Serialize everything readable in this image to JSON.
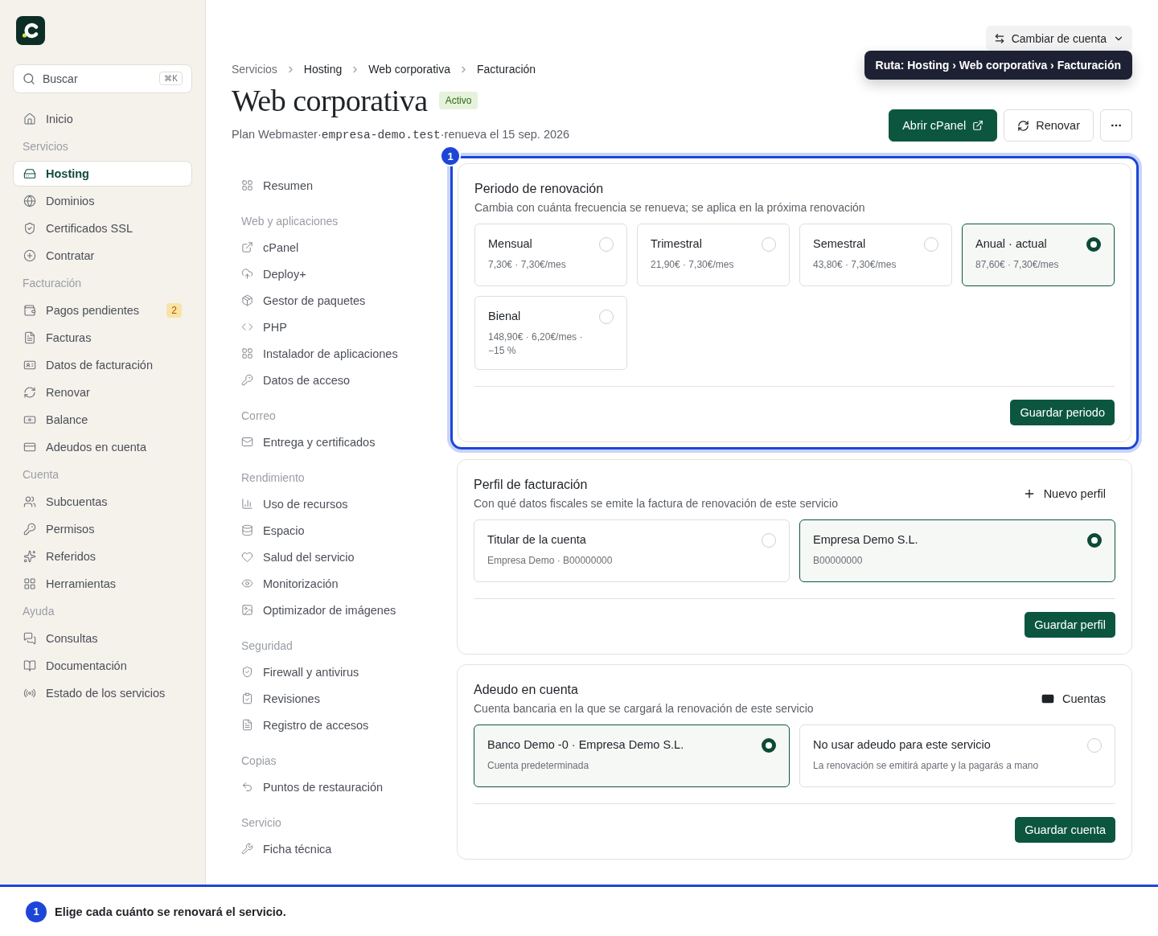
{
  "sidebar": {
    "search": {
      "placeholder": "Buscar",
      "shortcut": "⌘K"
    },
    "items": [
      {
        "kind": "item",
        "label": "Inicio",
        "selected": false
      },
      {
        "kind": "section",
        "label": "Servicios"
      },
      {
        "kind": "item",
        "label": "Hosting",
        "selected": true
      },
      {
        "kind": "item",
        "label": "Dominios",
        "selected": false
      },
      {
        "kind": "item",
        "label": "Certificados SSL",
        "selected": false
      },
      {
        "kind": "item",
        "label": "Contratar",
        "selected": false
      },
      {
        "kind": "section",
        "label": "Facturación"
      },
      {
        "kind": "item",
        "label": "Pagos pendientes",
        "selected": false,
        "badge": "2"
      },
      {
        "kind": "item",
        "label": "Facturas",
        "selected": false
      },
      {
        "kind": "item",
        "label": "Datos de facturación",
        "selected": false
      },
      {
        "kind": "item",
        "label": "Renovar",
        "selected": false
      },
      {
        "kind": "item",
        "label": "Balance",
        "selected": false
      },
      {
        "kind": "item",
        "label": "Adeudos en cuenta",
        "selected": false
      },
      {
        "kind": "section",
        "label": "Cuenta"
      },
      {
        "kind": "item",
        "label": "Subcuentas",
        "selected": false
      },
      {
        "kind": "item",
        "label": "Permisos",
        "selected": false
      },
      {
        "kind": "item",
        "label": "Referidos",
        "selected": false
      },
      {
        "kind": "item",
        "label": "Herramientas",
        "selected": false
      },
      {
        "kind": "section",
        "label": "Ayuda"
      },
      {
        "kind": "item",
        "label": "Consultas",
        "selected": false
      },
      {
        "kind": "item",
        "label": "Documentación",
        "selected": false
      },
      {
        "kind": "item",
        "label": "Estado de los servicios",
        "selected": false
      }
    ]
  },
  "account_switch": {
    "label": "Cambiar de cuenta"
  },
  "breadcrumb": [
    "Servicios",
    "Hosting",
    "Web corporativa",
    "Facturación"
  ],
  "tooltip": "Ruta: Hosting › Web corporativa › Facturación",
  "header": {
    "title": "Web corporativa",
    "status": "Activo",
    "separator": "·",
    "subtitle": [
      {
        "kind": "plain",
        "text": "Plan Webmaster"
      },
      {
        "kind": "code",
        "text": "empresa-demo.test"
      },
      {
        "kind": "plain",
        "text": "renueva el 15 sep. 2026"
      }
    ],
    "actions": [
      {
        "kind": "primary",
        "label": "Abrir cPanel"
      },
      {
        "kind": "secondary",
        "label": "Renovar"
      },
      {
        "kind": "more"
      }
    ]
  },
  "subnav": [
    {
      "items": [
        "Resumen"
      ]
    },
    {
      "title": "Web y aplicaciones",
      "items": [
        "cPanel",
        "Deploy+",
        "Gestor de paquetes",
        "PHP",
        "Instalador de aplicaciones",
        "Datos de acceso"
      ]
    },
    {
      "title": "Correo",
      "items": [
        "Entrega y certificados"
      ]
    },
    {
      "title": "Rendimiento",
      "items": [
        "Uso de recursos",
        "Espacio",
        "Salud del servicio",
        "Monitorización",
        "Optimizador de imágenes"
      ]
    },
    {
      "title": "Seguridad",
      "items": [
        "Firewall y antivirus",
        "Revisiones",
        "Registro de accesos"
      ]
    },
    {
      "title": "Copias",
      "items": [
        "Puntos de restauración"
      ]
    },
    {
      "title": "Servicio",
      "items": [
        "Ficha técnica"
      ]
    }
  ],
  "cards": [
    {
      "kind": "period",
      "highlighted": true,
      "step": "1",
      "title": "Periodo de renovación",
      "description": "Cambia con cuánta frecuencia se renueva; se aplica en la próxima renovación",
      "save": "Guardar periodo",
      "options": [
        {
          "title": "Mensual",
          "detail": "7,30€ · 7,30€/mes",
          "selected": false
        },
        {
          "title": "Trimestral",
          "detail": "21,90€ · 7,30€/mes",
          "selected": false
        },
        {
          "title": "Semestral",
          "detail": "43,80€ · 7,30€/mes",
          "selected": false
        },
        {
          "title": "Anual · actual",
          "detail": "87,60€ · 7,30€/mes",
          "selected": true
        },
        {
          "title": "Bienal",
          "detail": "148,90€ · 6,20€/mes · −15 %",
          "selected": false
        }
      ]
    },
    {
      "kind": "choice",
      "highlighted": false,
      "title": "Perfil de facturación",
      "description": "Con qué datos fiscales se emite la factura de renovación de este servicio",
      "save": "Guardar perfil",
      "action": {
        "kind": "add",
        "label": "Nuevo perfil"
      },
      "options": [
        {
          "title": "Titular de la cuenta",
          "detail": "Empresa Demo · B00000000",
          "selected": false
        },
        {
          "title": "Empresa Demo S.L.",
          "detail": "B00000000",
          "selected": true
        }
      ]
    },
    {
      "kind": "choice",
      "highlighted": false,
      "title": "Adeudo en cuenta",
      "description": "Cuenta bancaria en la que se cargará la renovación de este servicio",
      "save": "Guardar cuenta",
      "action": {
        "kind": "accounts",
        "label": "Cuentas"
      },
      "options": [
        {
          "title": "Banco Demo ‑0 · Empresa Demo S.L.",
          "detail": "Cuenta predeterminada",
          "selected": true
        },
        {
          "title": "No usar adeudo para este servicio",
          "detail": "La renovación se emitirá aparte y la pagarás a mano",
          "selected": false
        }
      ]
    }
  ],
  "guide": {
    "step": "1",
    "text": "Elige cada cuánto se renovará el servicio."
  }
}
